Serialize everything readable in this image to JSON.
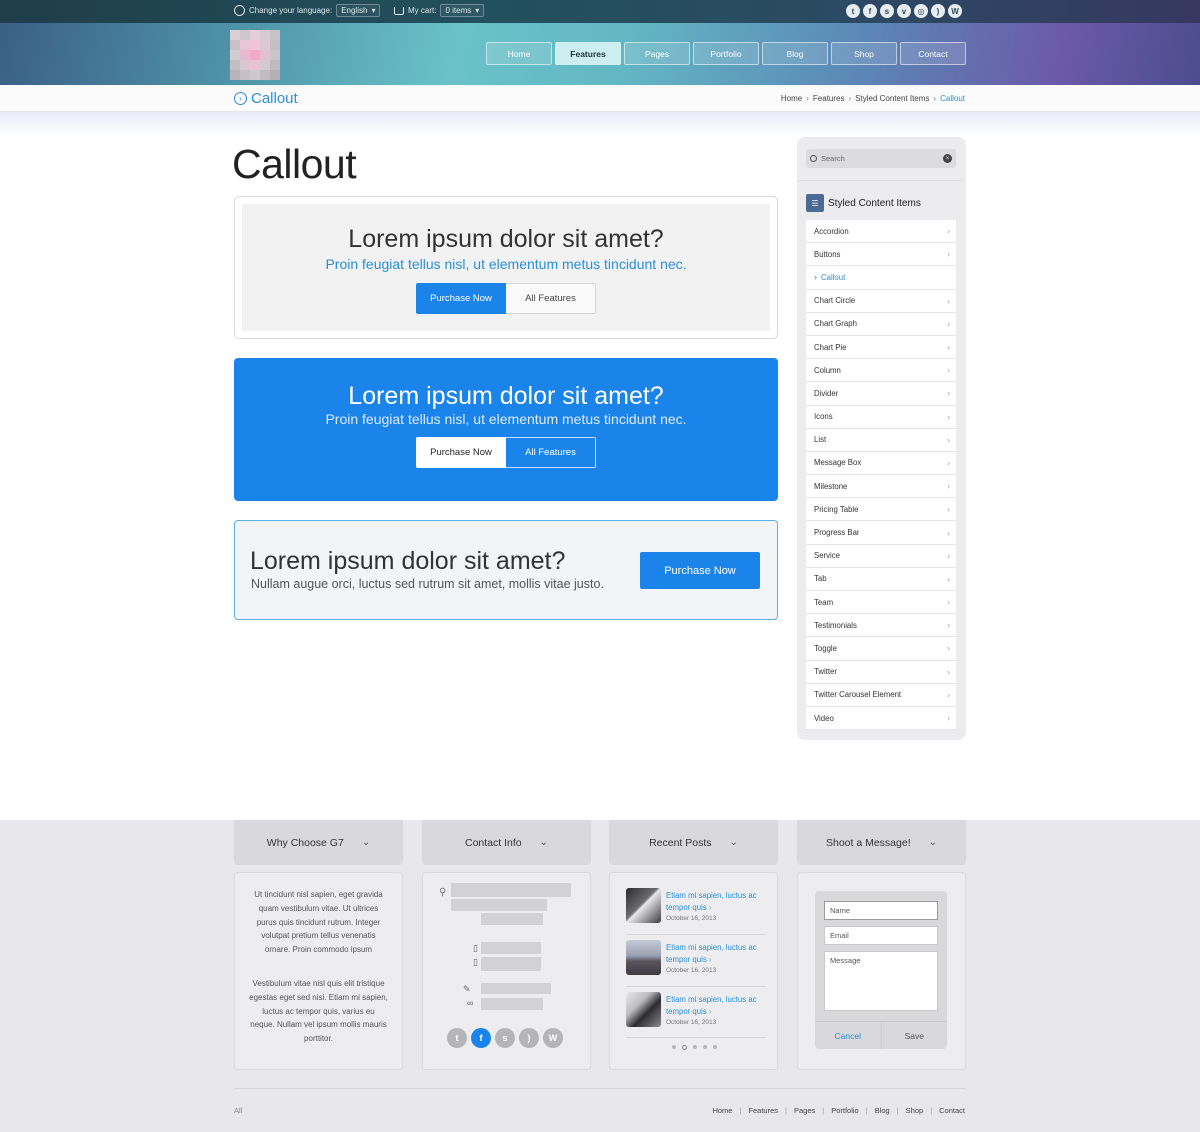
{
  "topbar": {
    "language_label": "Change your language:",
    "language_value": "English",
    "cart_label": "My cart:",
    "cart_value": "0 items",
    "socials": [
      "twitter",
      "facebook",
      "skype",
      "vimeo",
      "dribbble",
      "rss",
      "wordpress"
    ]
  },
  "nav": {
    "items": [
      "Home",
      "Features",
      "Pages",
      "Portfolio",
      "Blog",
      "Shop",
      "Contact"
    ],
    "active": "Features"
  },
  "breadcrumb": {
    "page_title": "Callout",
    "items": [
      "Home",
      "Features",
      "Styled Content Items"
    ],
    "current": "Callout"
  },
  "main": {
    "title": "Callout",
    "callout1": {
      "heading": "Lorem ipsum dolor sit amet?",
      "sub": "Proin feugiat tellus nisl, ut elementum metus tincidunt nec.",
      "primary": "Purchase Now",
      "secondary": "All Features"
    },
    "callout2": {
      "heading": "Lorem ipsum dolor sit amet?",
      "sub": "Proin feugiat tellus nisl, ut elementum metus tincidunt nec.",
      "primary": "Purchase Now",
      "secondary": "All Features"
    },
    "callout3": {
      "heading": "Lorem ipsum dolor sit amet?",
      "sub": "Nullam augue orci, luctus sed rutrum sit amet, mollis vitae justo.",
      "button": "Purchase Now"
    }
  },
  "sidebar": {
    "search_placeholder": "Search",
    "heading": "Styled Content Items",
    "items": [
      "Accordion",
      "Buttons",
      "Callout",
      "Chart Circle",
      "Chart Graph",
      "Chart Pie",
      "Column",
      "Divider",
      "Icons",
      "List",
      "Message Box",
      "Milestone",
      "Pricing Table",
      "Progress Bar",
      "Service",
      "Tab",
      "Team",
      "Testimonials",
      "Toggle",
      "Twitter",
      "Twitter Carousel Element",
      "Video"
    ],
    "active": "Callout"
  },
  "footer": {
    "columns": {
      "why": "Why Choose G7",
      "contact": "Contact Info",
      "posts": "Recent Posts",
      "message": "Shoot a Message!"
    },
    "why_p1": "Ut tincidunt nisl sapien, eget gravida quam vestibulum vitae. Ut ultrices purus quis tincidunt rutrum. Integer volutpat pretium tellus venenatis ornare. Proin commodo ipsum",
    "why_p2": "Vestibulum vitae nisl quis elit tristique egestas eget sed nisi. Etiam mi sapien, luctus ac tempor quis, varius eu neque. Nullam vel ipsum mollis mauris porttitor.",
    "posts": [
      {
        "title": "Etiam mi sapien, luctus ac tempor quis",
        "date": "October 16, 2013"
      },
      {
        "title": "Etiam mi sapien, luctus ac tempor quis",
        "date": "October 16, 2013"
      },
      {
        "title": "Etiam mi sapien, luctus ac tempor quis",
        "date": "October 16, 2013"
      }
    ],
    "form": {
      "name": "Name",
      "email": "Email",
      "message": "Message",
      "cancel": "Cancel",
      "save": "Save"
    },
    "copyright": "All",
    "nav": [
      "Home",
      "Features",
      "Pages",
      "Portfolio",
      "Blog",
      "Shop",
      "Contact"
    ]
  },
  "colors": {
    "accent": "#1b84ea",
    "link": "#2a8fd6"
  }
}
